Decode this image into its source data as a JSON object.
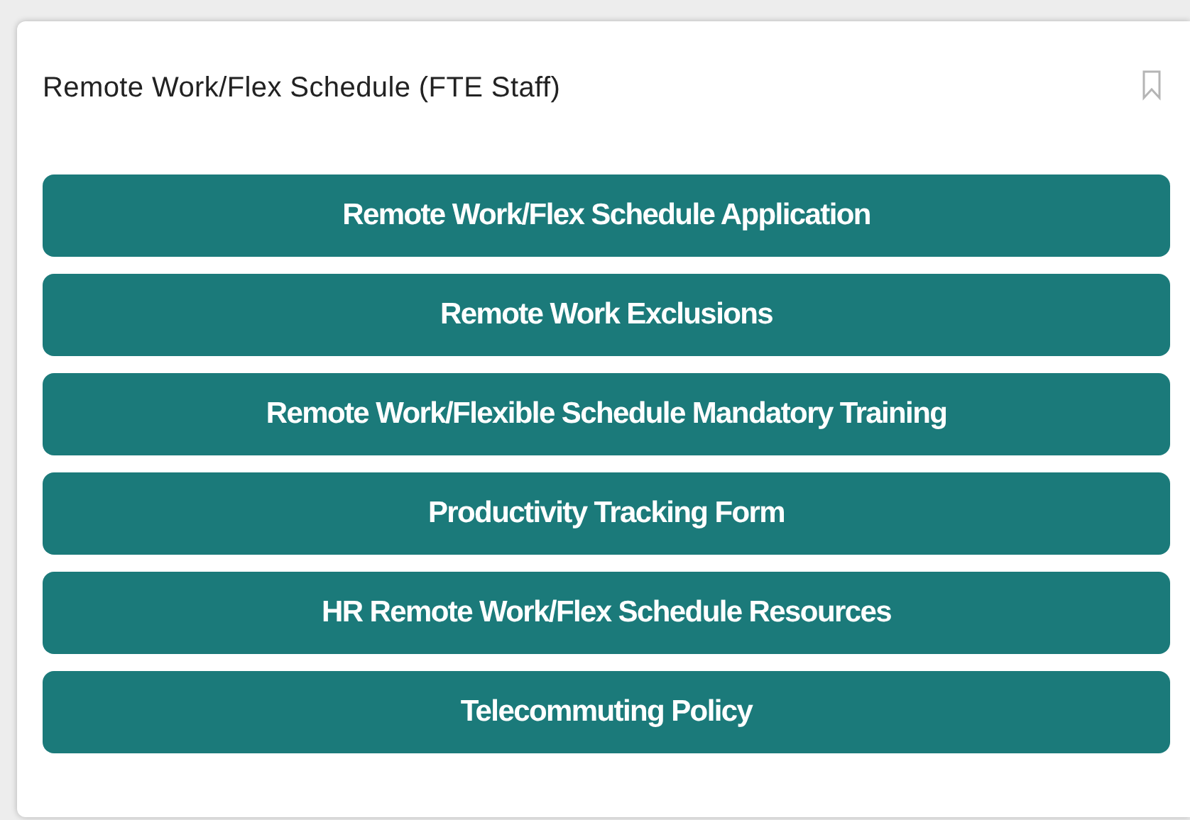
{
  "card": {
    "title": "Remote Work/Flex Schedule (FTE Staff)",
    "bookmarked": false
  },
  "links": [
    {
      "label": "Remote Work/Flex Schedule Application"
    },
    {
      "label": "Remote Work Exclusions"
    },
    {
      "label": "Remote Work/Flexible Schedule Mandatory Training"
    },
    {
      "label": "Productivity Tracking Form"
    },
    {
      "label": "HR Remote Work/Flex Schedule Resources"
    },
    {
      "label": "Telecommuting Policy"
    }
  ]
}
